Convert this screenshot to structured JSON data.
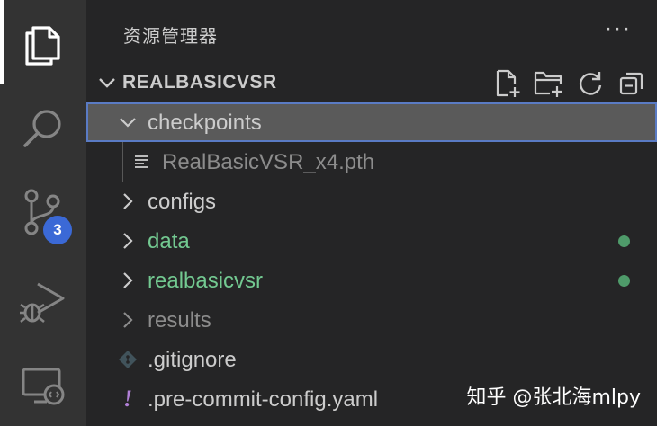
{
  "sidebar": {
    "title": "资源管理器",
    "more": "···"
  },
  "section": {
    "title": "REALBASICVSR"
  },
  "activity": {
    "scm_badge": "3"
  },
  "tree": [
    {
      "label": "checkpoints",
      "type": "folder",
      "expanded": true,
      "selected": true,
      "color": "#cccccc"
    },
    {
      "label": "RealBasicVSR_x4.pth",
      "type": "file",
      "child": true,
      "color": "#8c8c8c"
    },
    {
      "label": "configs",
      "type": "folder",
      "expanded": false,
      "color": "#cccccc"
    },
    {
      "label": "data",
      "type": "folder",
      "expanded": false,
      "modified": true,
      "color": "#73c991"
    },
    {
      "label": "realbasicvsr",
      "type": "folder",
      "expanded": false,
      "modified": true,
      "color": "#73c991"
    },
    {
      "label": "results",
      "type": "folder",
      "expanded": false,
      "color": "#8c8c8c"
    },
    {
      "label": ".gitignore",
      "type": "file",
      "icon": "git-icon",
      "color": "#cccccc"
    },
    {
      "label": ".pre-commit-config.yaml",
      "type": "file",
      "icon": "exclamation-icon",
      "color": "#cccccc"
    }
  ],
  "watermark": "知乎 @张北海mlpy",
  "colors": {
    "activity_bar": "#333333",
    "sidebar": "#252526",
    "selected_row": "#5a5a5a",
    "focus_outline": "#5a7bc4",
    "modified_green": "#73c991",
    "badge": "#3b69d6"
  }
}
